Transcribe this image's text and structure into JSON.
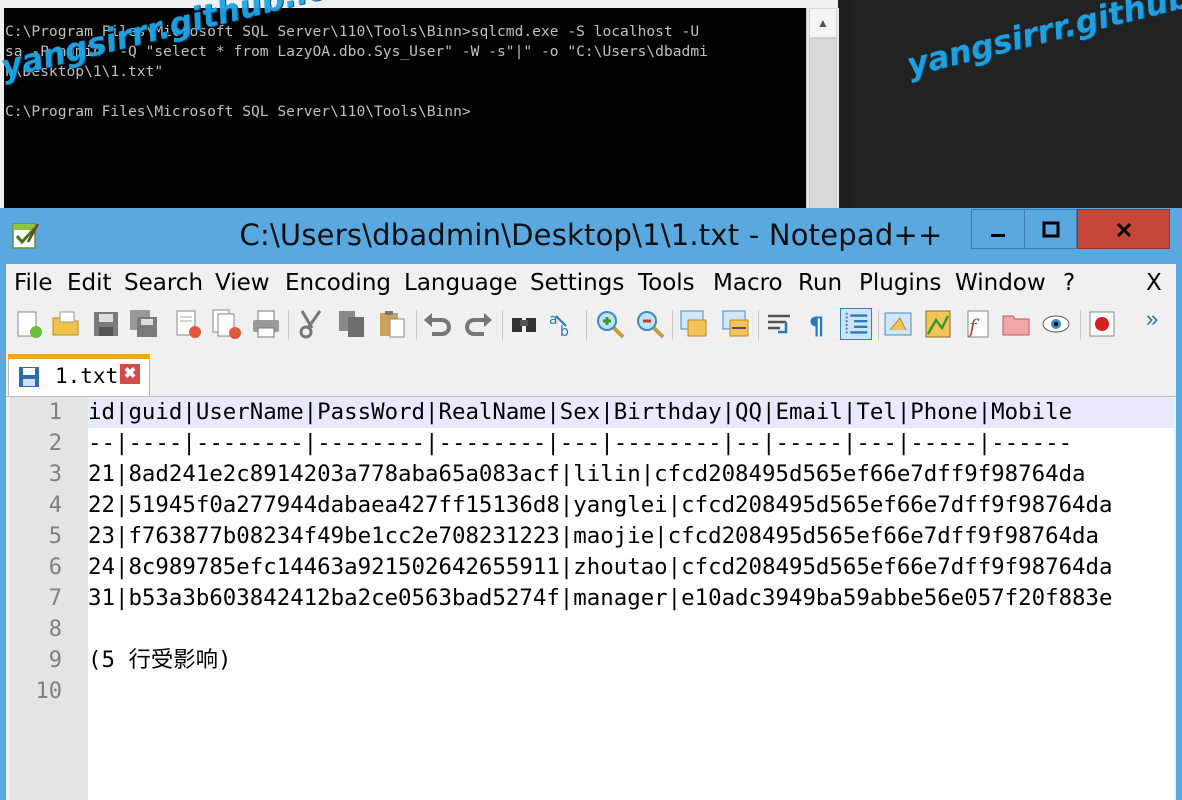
{
  "console": {
    "lines": [
      "C:\\Program Files\\Microsoft SQL Server\\110\\Tools\\Binn>sqlcmd.exe -S localhost -U",
      "sa -P admin  -Q \"select * from LazyOA.dbo.Sys_User\" -W -s\"|\" -o \"C:\\Users\\dbadmi",
      "n\\Desktop\\1\\1.txt\"",
      "",
      "C:\\Program Files\\Microsoft SQL Server\\110\\Tools\\Binn>"
    ]
  },
  "watermark": "yangsirrr.github.io",
  "npp": {
    "title": "C:\\Users\\dbadmin\\Desktop\\1\\1.txt - Notepad++",
    "window_buttons": {
      "minimize": "—",
      "maximize": "☐",
      "close": "✕"
    },
    "menu": [
      "File",
      "Edit",
      "Search",
      "View",
      "Encoding",
      "Language",
      "Settings",
      "Tools",
      "Macro",
      "Run",
      "Plugins",
      "Window",
      "?"
    ],
    "menu_close": "X",
    "toolbar": [
      "new-icon",
      "open-icon",
      "save-icon",
      "save-all-icon",
      "close-icon",
      "close-all-icon",
      "print-icon",
      "cut-icon",
      "copy-icon",
      "paste-icon",
      "undo-icon",
      "redo-icon",
      "find-icon",
      "replace-icon",
      "zoom-in-icon",
      "zoom-out-icon",
      "sync-vertical-icon",
      "sync-horizontal-icon",
      "word-wrap-icon",
      "show-all-chars-icon",
      "indent-guide-icon",
      "user-language-icon",
      "document-map-icon",
      "function-list-icon",
      "folder-workspace-icon",
      "monitoring-icon",
      "record-macro-icon"
    ],
    "toolbar_overflow": "»",
    "tab": {
      "name": "1.txt",
      "close": "✖"
    },
    "lines": [
      "id|guid|UserName|PassWord|RealName|Sex|Birthday|QQ|Email|Tel|Phone|Mobile",
      "--|----|--------|--------|--------|---|--------|--|-----|---|-----|------",
      "21|8ad241e2c8914203a778aba65a083acf|lilin|cfcd208495d565ef66e7dff9f98764da",
      "22|51945f0a277944dabaea427ff15136d8|yanglei|cfcd208495d565ef66e7dff9f98764da",
      "23|f763877b08234f49be1cc2e708231223|maojie|cfcd208495d565ef66e7dff9f98764da",
      "24|8c989785efc14463a921502642655911|zhoutao|cfcd208495d565ef66e7dff9f98764da",
      "31|b53a3b603842412ba2ce0563bad5274f|manager|e10adc3949ba59abbe56e057f20f883e",
      "",
      "(5 行受影响)",
      ""
    ]
  }
}
